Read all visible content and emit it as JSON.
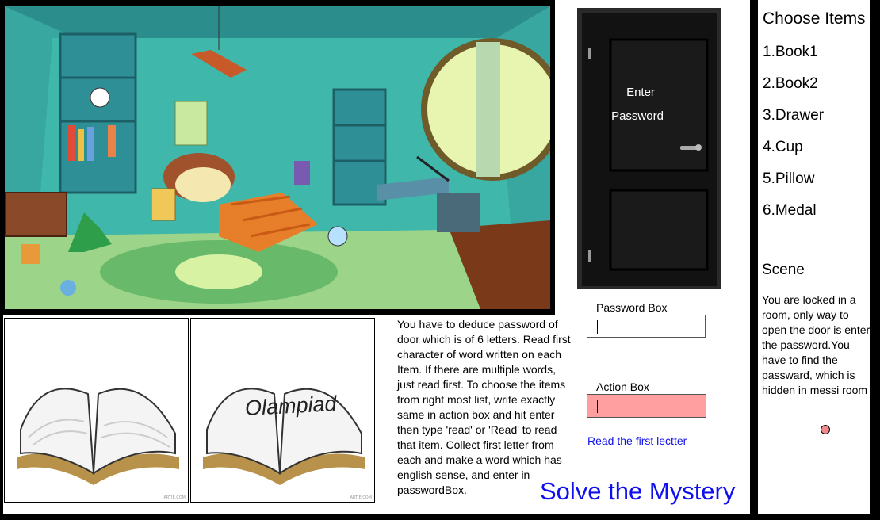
{
  "room": {
    "description_icon": "cartoon-bedroom-scene"
  },
  "books": [
    {
      "title": ""
    },
    {
      "title": "Olampiad"
    }
  ],
  "instructions": "You have to deduce password of door which is of 6 letters. Read first character of word written on each Item. If there are multiple words, just read first. To choose the items from right most list, write exactly same in action box and hit enter then type 'read' or 'Read' to read that item. Collect first letter from each and make a word which has english sense, and enter in passwordBox.",
  "door": {
    "line1": "Enter",
    "line2": "Password"
  },
  "password_box": {
    "label": "Password Box",
    "value": ""
  },
  "action_box": {
    "label": "Action Box",
    "value": "",
    "bg_color": "#ff9f9f"
  },
  "hint": "Read the first lectter",
  "title": "Solve the Mystery",
  "items_panel": {
    "title": "Choose Items",
    "items": [
      "1.Book1",
      "2.Book2",
      "3.Drawer",
      "4.Cup",
      "5.Pillow",
      "6.Medal"
    ]
  },
  "scene": {
    "title": "Scene",
    "text": "You are locked in a room, only way to open the door is enter the password.You have to find the passward, which is hidden in messi room"
  },
  "colors": {
    "link_blue": "#1010ee",
    "action_red": "#ff9f9f"
  }
}
